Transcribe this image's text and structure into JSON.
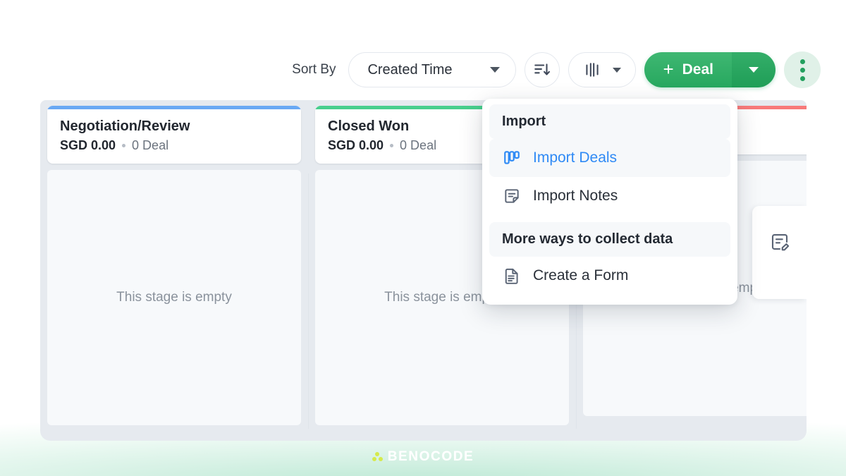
{
  "toolbar": {
    "sort_by_label": "Sort By",
    "sort_field_value": "Created Time",
    "sort_direction_icon": "sort-descending-icon",
    "view_icon": "kanban-view-icon",
    "deal_button_label": "Deal",
    "deal_button_plus": "+",
    "more_actions_icon": "kebab-menu-icon"
  },
  "menu": {
    "sections": [
      {
        "title": "Import"
      },
      {
        "title": "More ways to collect data"
      }
    ],
    "import_title": "Import",
    "more_ways_title": "More ways to collect data",
    "items": [
      {
        "label": "Import Deals",
        "icon": "kanban-columns-icon",
        "active": true
      },
      {
        "label": "Import Notes",
        "icon": "note-icon",
        "active": false
      },
      {
        "label": "Create a Form",
        "icon": "document-icon",
        "active": false
      }
    ]
  },
  "board": {
    "empty_text": "This stage is empty",
    "columns": [
      {
        "title": "Negotiation/Review",
        "amount": "SGD 0.00",
        "deal_count": "0 Deal",
        "accent": "#6aa9f4",
        "empty_text": "This stage is empty"
      },
      {
        "title": "Closed Won",
        "amount": "SGD 0.00",
        "deal_count": "0 Deal",
        "accent": "#48cf8d",
        "empty_text": "This stage is empty"
      },
      {
        "title": "",
        "amount": "",
        "deal_count": "",
        "accent": "#f87a7a",
        "empty_text": "This stage is empty"
      }
    ]
  },
  "side_panel": {
    "icon": "note-edit-icon"
  },
  "brand": {
    "name": "BENOCODE",
    "mark_icon": "benocode-logo-mark"
  },
  "colors": {
    "accent_green": "#27a85f",
    "link_blue": "#2f8af5",
    "board_bg": "#e6eaef",
    "column_bg": "#f7f9fb"
  }
}
